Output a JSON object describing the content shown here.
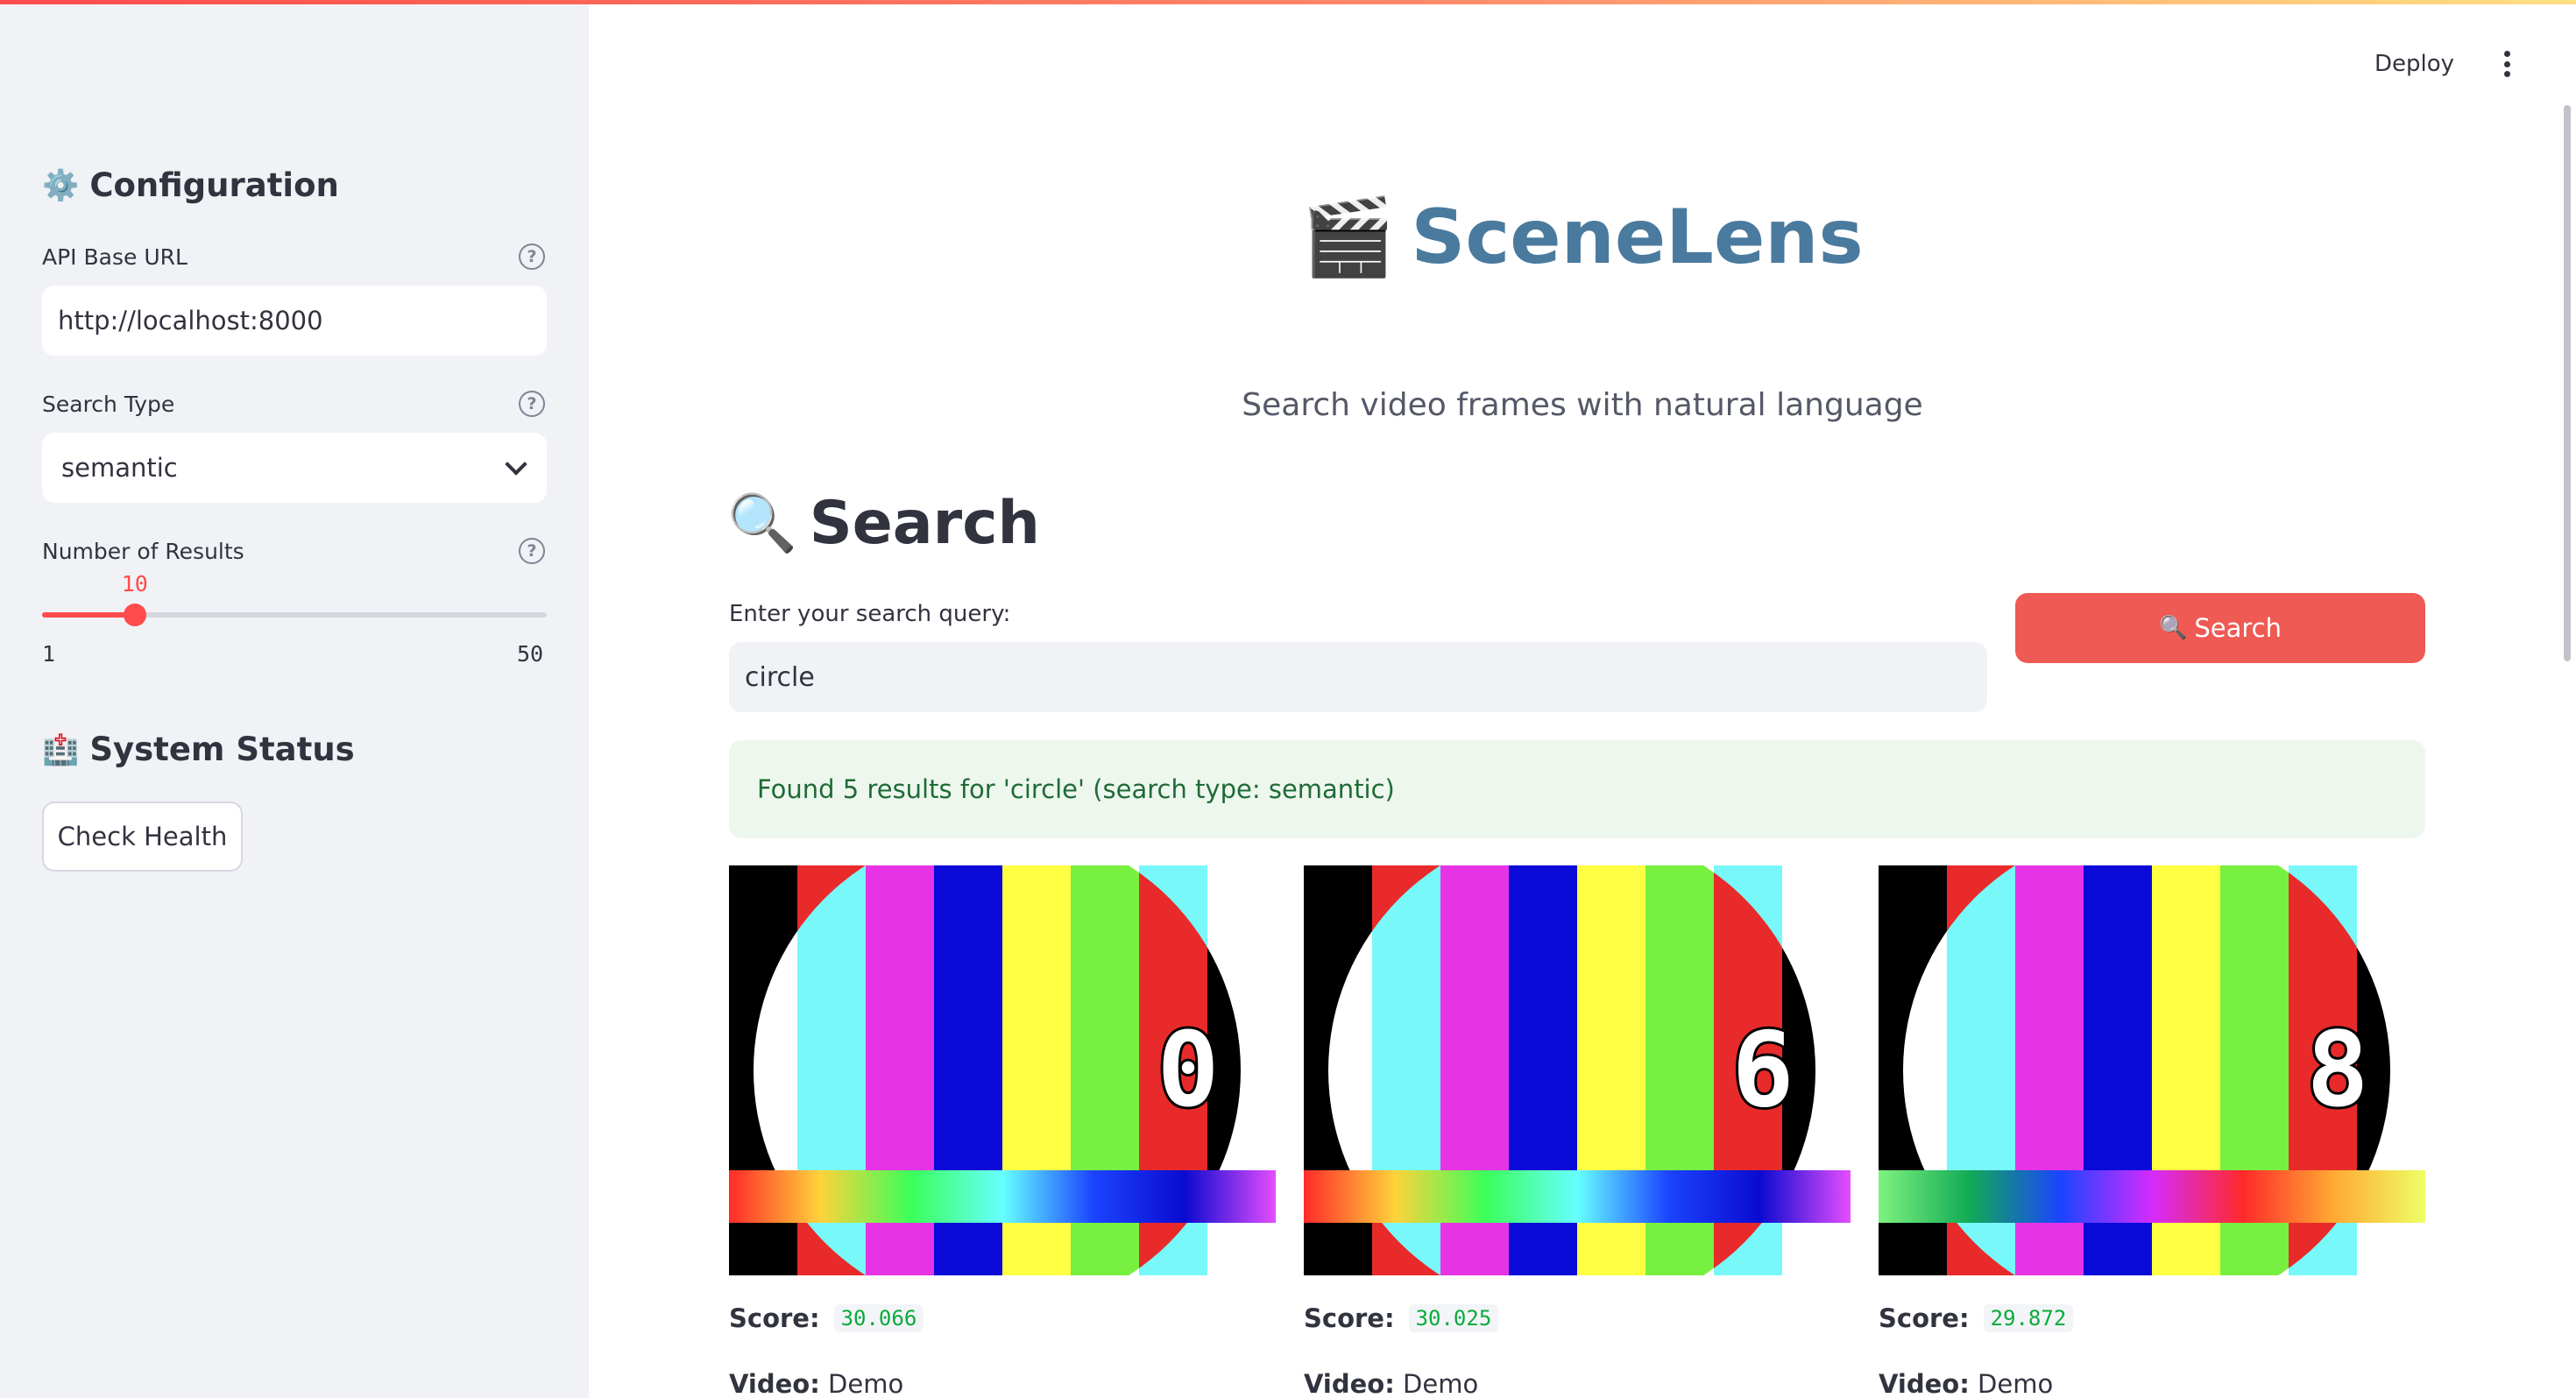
{
  "sidebar": {
    "config_icon": "gear-icon",
    "config_title": "Configuration",
    "api_url": {
      "label": "API Base URL",
      "value": "http://localhost:8000"
    },
    "search_type": {
      "label": "Search Type",
      "value": "semantic"
    },
    "num_results": {
      "label": "Number of Results",
      "value": 10,
      "min": 1,
      "max": 50,
      "value_text": "10",
      "min_text": "1",
      "max_text": "50"
    },
    "status_icon": "hospital-icon",
    "status_title": "System Status",
    "check_health_label": "Check Health"
  },
  "header": {
    "deploy_label": "Deploy"
  },
  "main": {
    "app_icon": "clapper-board-icon",
    "app_title": "SceneLens",
    "subtitle": "Search video frames with natural language",
    "search_heading": "Search",
    "query_label": "Enter your search query:",
    "query_value": "circle",
    "search_button_label": "Search",
    "success_message": "Found 5 results for 'circle' (search type: semantic)"
  },
  "results": [
    {
      "digit": "0",
      "score_label": "Score:",
      "score": "30.066",
      "video_label": "Video:",
      "video": "Demo"
    },
    {
      "digit": "6",
      "score_label": "Score:",
      "score": "30.025",
      "video_label": "Video:",
      "video": "Demo"
    },
    {
      "digit": "8",
      "score_label": "Score:",
      "score": "29.872",
      "video_label": "Video:",
      "video": "Demo"
    }
  ],
  "colors": {
    "accent": "#ff4b4b",
    "primary_button": "#ef5a54",
    "title_blue": "#4a7a9e",
    "success_bg": "#edf7ee",
    "success_text": "#1f6b36",
    "score_green": "#09ab3b"
  }
}
